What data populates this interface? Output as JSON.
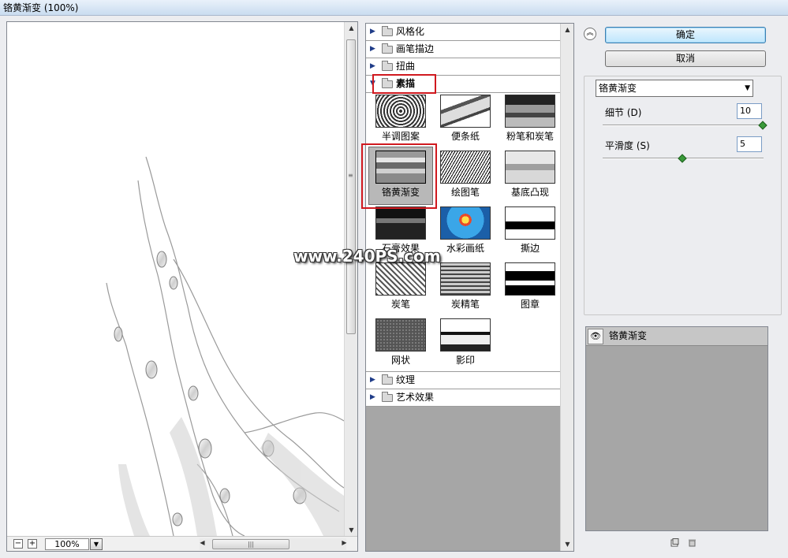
{
  "window": {
    "title": "铬黄渐变 (100%)"
  },
  "preview": {
    "zoom_out_label": "−",
    "zoom_in_label": "+",
    "zoom_value": "100%"
  },
  "gallery": {
    "categories_top": [
      {
        "label": "风格化"
      },
      {
        "label": "画笔描边"
      },
      {
        "label": "扭曲"
      }
    ],
    "open_category": {
      "label": "素描"
    },
    "filters": [
      {
        "label": "半调图案"
      },
      {
        "label": "便条纸"
      },
      {
        "label": "粉笔和炭笔"
      },
      {
        "label": "铬黄渐变",
        "selected": true
      },
      {
        "label": "绘图笔"
      },
      {
        "label": "基底凸现"
      },
      {
        "label": "石膏效果"
      },
      {
        "label": "水彩画纸"
      },
      {
        "label": "撕边"
      },
      {
        "label": "炭笔"
      },
      {
        "label": "炭精笔"
      },
      {
        "label": "图章"
      },
      {
        "label": "网状"
      },
      {
        "label": "影印"
      }
    ],
    "categories_bottom": [
      {
        "label": "纹理"
      },
      {
        "label": "艺术效果"
      }
    ]
  },
  "watermark": "www.240PS.com",
  "actions": {
    "ok_label": "确定",
    "cancel_label": "取消"
  },
  "settings": {
    "filter_select": "铬黄渐变",
    "detail": {
      "label": "细节 (D)",
      "value": "10",
      "slider_fraction": 1.0
    },
    "smoothness": {
      "label": "平滑度 (S)",
      "value": "5",
      "slider_fraction": 0.5
    }
  },
  "layers": {
    "items": [
      {
        "name": "铬黄渐变"
      }
    ]
  },
  "icons": {
    "collapse": "double-chevron-up-icon",
    "new_layer": "new-effect-layer-icon",
    "delete_layer": "trash-icon",
    "eye": "eye-icon"
  }
}
